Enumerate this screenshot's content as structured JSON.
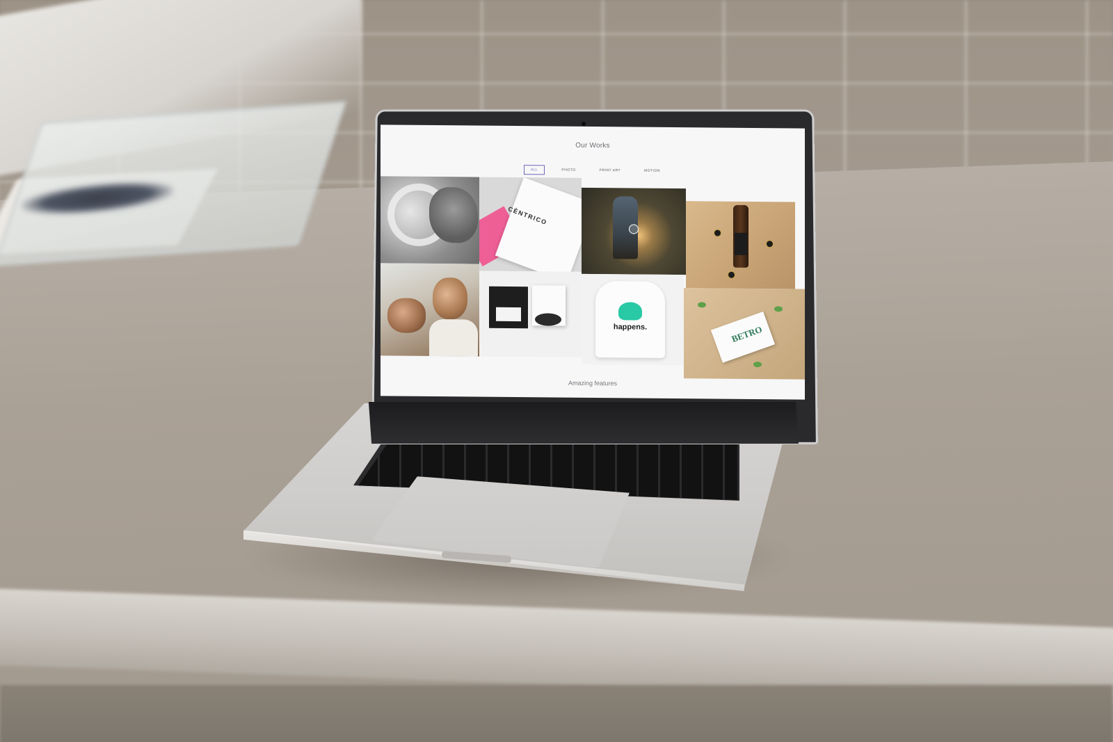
{
  "screen": {
    "title": "Our Works",
    "filters": [
      {
        "label": "ALL",
        "active": true
      },
      {
        "label": "PHOTO",
        "active": false
      },
      {
        "label": "PRINT ART",
        "active": false
      },
      {
        "label": "MOTION",
        "active": false
      }
    ],
    "portfolio_items": [
      {
        "subject": "pottery wheel photo"
      },
      {
        "subject": "stationery card",
        "brand_text": "CÈNTRICO"
      },
      {
        "subject": "hiker at sunset",
        "has_play_button": true
      },
      {
        "subject": "craft beer bottle"
      },
      {
        "subject": "barber shop photo"
      },
      {
        "subject": "black and white packaging boxes"
      },
      {
        "subject": "white sweatshirt",
        "print_text": "happens."
      },
      {
        "subject": "business card with greenery",
        "brand_text": "BETRO"
      }
    ],
    "footer": "Amazing features"
  },
  "colors": {
    "active_filter": "#6d68b8",
    "pink_accent": "#ee5f96",
    "mint_accent": "#29c9a5"
  }
}
